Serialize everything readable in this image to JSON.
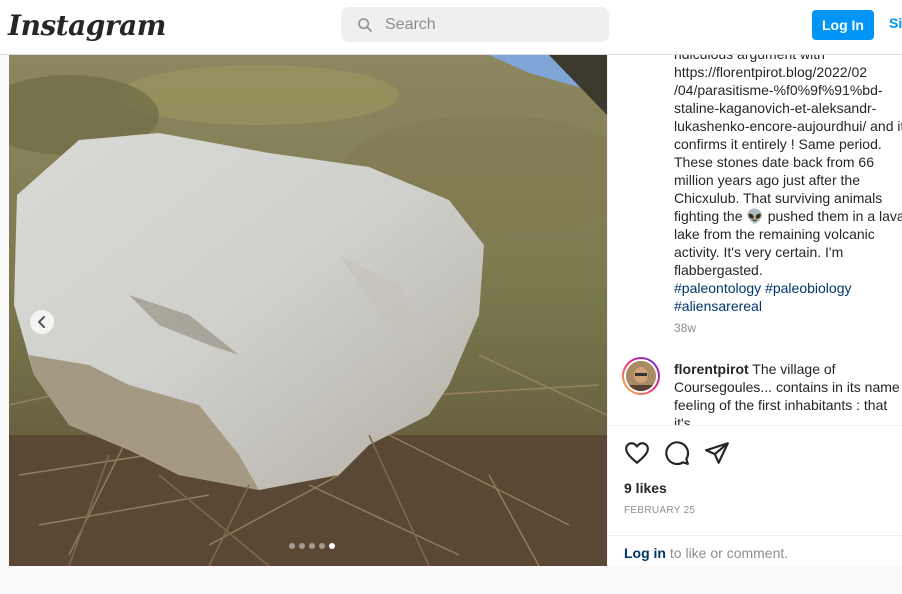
{
  "header": {
    "logo_text": "Instagram",
    "search": {
      "placeholder": "Search"
    },
    "login_button": "Log In",
    "signup_text": "Sign Up"
  },
  "post": {
    "image_alt": "Large pale limestone boulder on dry grass hillside",
    "carousel": {
      "slide_count": 5,
      "active_index": 4
    },
    "caption": {
      "lines": [
        "ridiculous argument with",
        "https://florentpirot.blog/2022/02",
        "/04/parasitisme-%f0%9f%91%bd-",
        "staline-kaganovich-et-aleksandr-",
        "lukashenko-encore-aujourdhui/ and it",
        "confirms it entirely ! Same period.",
        "These stones date back from 66",
        "million years ago just after the",
        "Chicxulub. That surviving animals",
        "fighting the",
        "pushed them in a lava",
        "lake from the remaining volcanic",
        "activity. It's very certain. I'm",
        "flabbergasted."
      ],
      "emoji": "👽",
      "hashtags": [
        "#paleontology",
        "#paleobiology",
        "#aliensarereal"
      ],
      "time": "38w"
    },
    "comment": {
      "username": "florentpirot",
      "text_lines": [
        "The village of",
        "Coursegoules... contains in its name",
        "feeling of the first inhabitants : that it's"
      ]
    },
    "likes": "9 likes",
    "date": "FEBRUARY 25",
    "login_prompt": {
      "link": "Log in",
      "rest": " to like or comment."
    }
  },
  "colors": {
    "accent": "#0095f6",
    "link": "#00376b",
    "muted": "#8e8e8e"
  }
}
